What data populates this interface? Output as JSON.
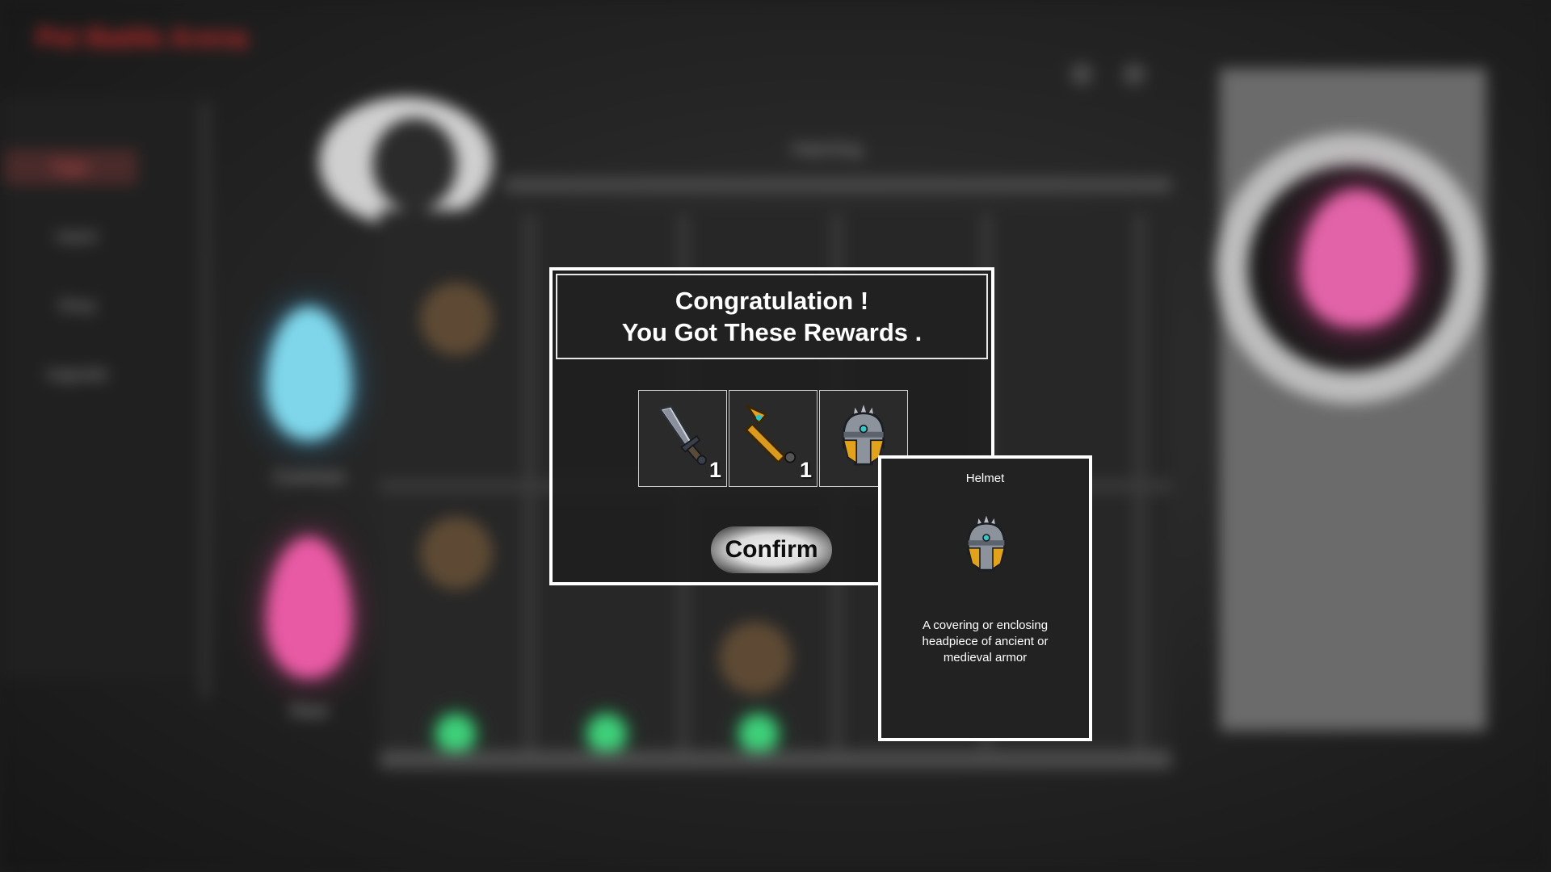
{
  "background": {
    "game_title": "Pet Battle Arena",
    "tabs": [
      "Eggs",
      "Hatch",
      "Shop",
      "Upgrade"
    ],
    "egg_labels": [
      "Common",
      "Rare"
    ],
    "top_label": "Hatching"
  },
  "reward_dialog": {
    "title_line1": "Congratulation !",
    "title_line2": "You Got These Rewards .",
    "rewards": [
      {
        "name": "Sword",
        "icon": "sword-icon",
        "quantity": "1"
      },
      {
        "name": "Spear",
        "icon": "spear-icon",
        "quantity": "1"
      },
      {
        "name": "Helmet",
        "icon": "helmet-icon",
        "quantity": ""
      }
    ],
    "confirm_label": "Confirm"
  },
  "tooltip": {
    "title": "Helmet",
    "icon": "helmet-icon",
    "description": "A covering or enclosing headpiece of ancient or medieval armor"
  },
  "colors": {
    "border": "#ffffff",
    "panel": "#222222",
    "accent_red": "#c32a2a",
    "egg_blue": "#7fd6ea",
    "egg_pink": "#e85aa4"
  }
}
